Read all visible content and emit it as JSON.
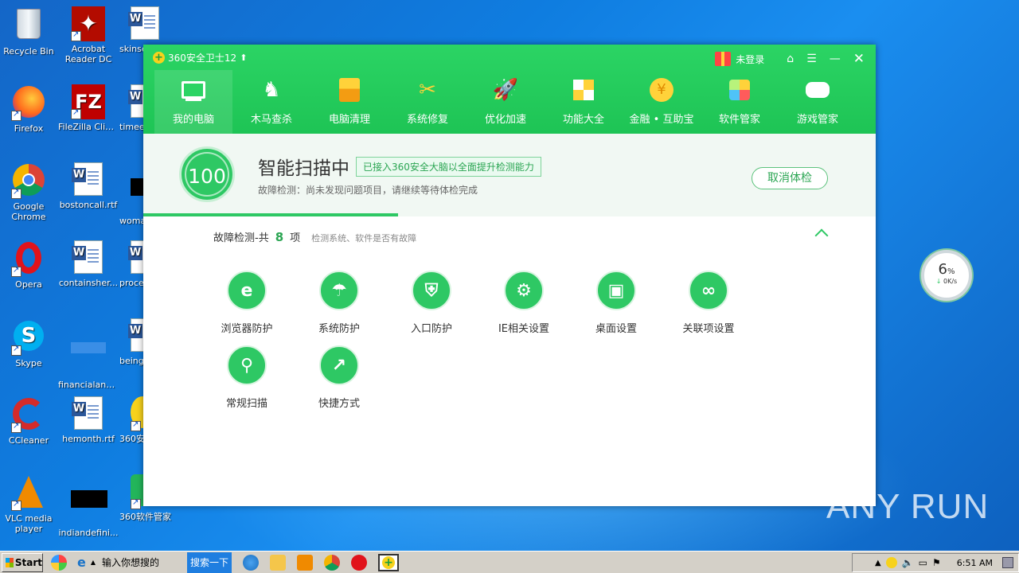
{
  "desktop": {
    "icons": [
      {
        "label": "Recycle Bin"
      },
      {
        "label": "Acrobat Reader DC"
      },
      {
        "label": "skinse"
      },
      {
        "label": "Firefox"
      },
      {
        "label": "FileZilla Client"
      },
      {
        "label": "timeel"
      },
      {
        "label": "Google Chrome"
      },
      {
        "label": "bostoncall.rtf"
      },
      {
        "label": "woma"
      },
      {
        "label": "Opera"
      },
      {
        "label": "containsher..."
      },
      {
        "label": "proce"
      },
      {
        "label": "Skype"
      },
      {
        "label": "financialann..."
      },
      {
        "label": "being"
      },
      {
        "label": "CCleaner"
      },
      {
        "label": "hemonth.rtf"
      },
      {
        "label": "360安"
      },
      {
        "label": "VLC media player"
      },
      {
        "label": "indiandefini..."
      },
      {
        "label": "360软件管家"
      }
    ]
  },
  "app": {
    "title": "360安全卫士12",
    "login": "未登录",
    "nav": [
      "我的电脑",
      "木马查杀",
      "电脑清理",
      "系统修复",
      "优化加速",
      "功能大全",
      "金融 • 互助宝",
      "软件管家",
      "游戏管家"
    ],
    "score": "100",
    "scan_title": "智能扫描中",
    "scan_badge": "已接入360安全大脑以全面提升检测能力",
    "scan_sub": "故障检测：尚未发现问题项目，请继续等待体检完成",
    "cancel_label": "取消体检",
    "section_title": "故障检测-共",
    "section_count": "8",
    "section_unit": "项",
    "section_desc": "检测系统、软件是否有故障",
    "tiles": [
      "浏览器防护",
      "系统防护",
      "入口防护",
      "IE相关设置",
      "桌面设置",
      "关联项设置",
      "常规扫描",
      "快捷方式"
    ]
  },
  "speed_widget": {
    "percent": "6",
    "unit": "%",
    "rate": "0K/s"
  },
  "taskbar": {
    "start": "Start",
    "ie_search_placeholder": "输入你想搜的",
    "search_button": "搜索一下",
    "clock": "6:51 AM"
  },
  "watermark": "ANY RUN",
  "colors": {
    "accent": "#1ec455",
    "desktop": "#1a7fe0"
  }
}
